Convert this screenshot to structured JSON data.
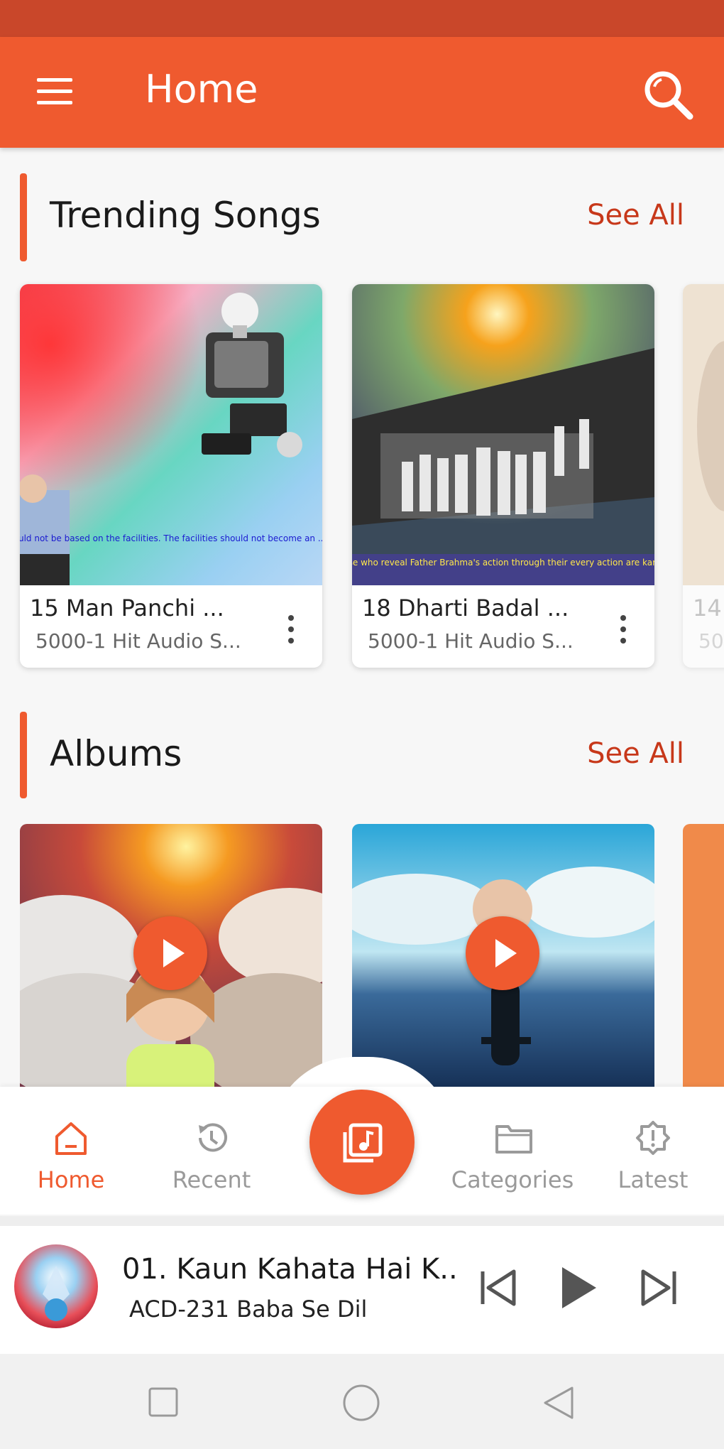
{
  "appbar": {
    "title": "Home",
    "menu_icon": "hamburger-menu-icon",
    "search_icon": "search-icon"
  },
  "trending": {
    "title": "Trending Songs",
    "see_all": "See All",
    "items": [
      {
        "title": "15 Man Panchi ...",
        "subtitle": "5000-1 Hit Audio S...",
        "caption": "Your spiritual endeavour should not be based on the facilities. The facilities should not become an ... to your spiritual endeavour."
      },
      {
        "title": "18 Dharti Badal ...",
        "subtitle": "5000-1 Hit Audio S...",
        "caption": "Only those who reveal Father Brahma's action through their every action are karma yogis"
      },
      {
        "title": "14",
        "subtitle": "50"
      }
    ]
  },
  "albums": {
    "title": "Albums",
    "see_all": "See All"
  },
  "bottom_nav": {
    "items": [
      {
        "label": "Home",
        "icon": "home-icon",
        "active": true
      },
      {
        "label": "Recent",
        "icon": "history-icon",
        "active": false
      },
      {
        "label": "Categories",
        "icon": "folder-icon",
        "active": false
      },
      {
        "label": "Latest",
        "icon": "badge-alert-icon",
        "active": false
      }
    ],
    "center_icon": "music-library-icon"
  },
  "player": {
    "song": "01. Kaun Kahata Hai K..",
    "album": "ACD-231 Baba Se Dil",
    "controls": [
      "skip-previous-icon",
      "play-icon",
      "skip-next-icon"
    ]
  },
  "system_nav": [
    "recents-square-icon",
    "home-circle-icon",
    "back-triangle-icon"
  ],
  "colors": {
    "primary": "#ef5a2f",
    "status_bar": "#c9472a",
    "accent_text": "#c7381a"
  }
}
